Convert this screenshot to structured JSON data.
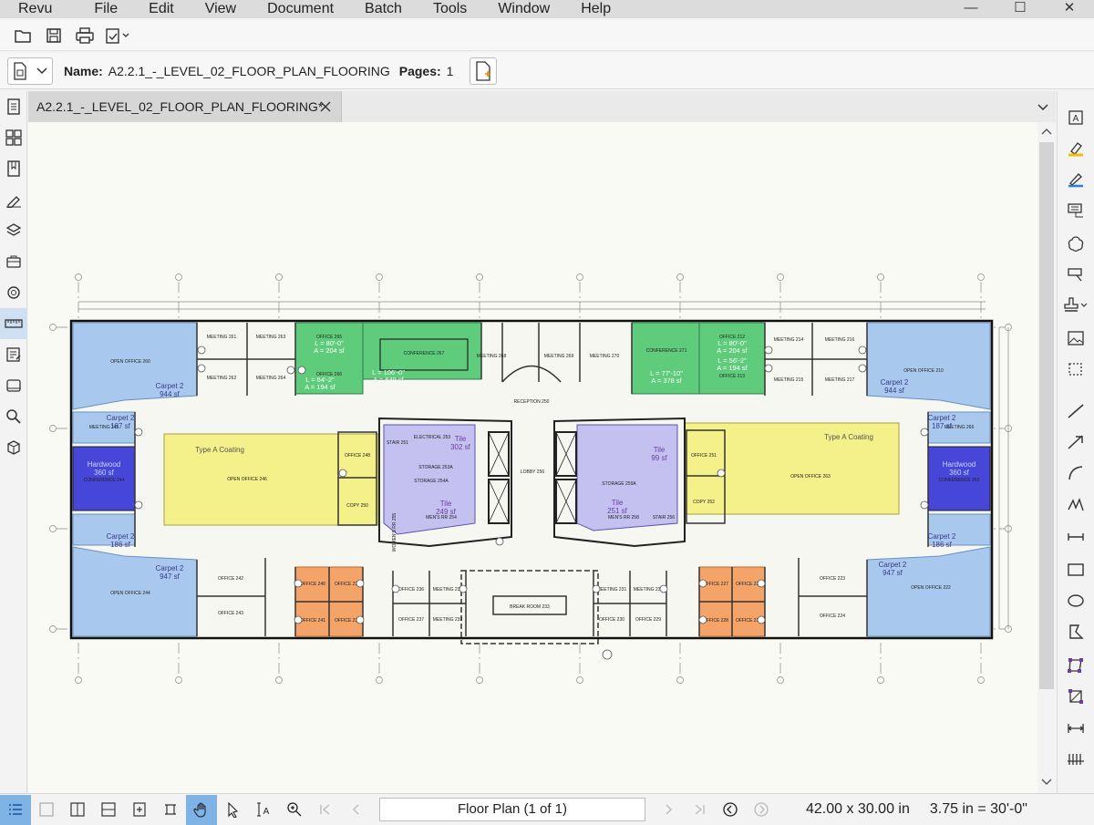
{
  "menu": [
    "Revu",
    "File",
    "Edit",
    "View",
    "Document",
    "Batch",
    "Tools",
    "Window",
    "Help"
  ],
  "window_controls": [
    "—",
    "☐",
    "✕"
  ],
  "document": {
    "name_label": "Name:",
    "name_value": "A2.2.1_-_LEVEL_02_FLOOR_PLAN_FLOORING",
    "pages_label": "Pages:",
    "pages_value": "1"
  },
  "tab": {
    "title": "A2.2.1_-_LEVEL_02_FLOOR_PLAN_FLOORING*"
  },
  "plan": {
    "top_rooms_left": [
      "OPEN OFFICE 260",
      "MEETING 261",
      "MEETING 263",
      "MEETING 262",
      "MEETING 264",
      "OFFICE 265",
      "OFFICE 266",
      "CONFERENCE 267"
    ],
    "top_rooms_center": [
      "MEETING 268",
      "MEETING 269",
      "MEETING 270"
    ],
    "top_rooms_right": [
      "CONFERENCE 271",
      "OFFICE 212",
      "OFFICE 213",
      "MEETING 214",
      "MEETING 216",
      "MEETING 215",
      "MEETING 217",
      "OPEN OFFICE 210"
    ],
    "reception": "RECEPTION 250",
    "lobby": "LOBBY 256",
    "core_left": [
      "STAIR 251",
      "ELECTRICAL 253",
      "STORAGE 253A",
      "STORAGE 254A",
      "MEN'S RR 254",
      "WOMEN'S RR 255"
    ],
    "core_right": [
      "STORAGE 259A",
      "MEN'S RR 258",
      "STAIR 256"
    ],
    "open_office_left": "OPEN OFFICE 246",
    "open_office_right": "OPEN OFFICE 263",
    "office_248": "OFFICE 248",
    "copy_250": "COPY 250",
    "office_251": "OFFICE 251",
    "copy_252": "COPY 252",
    "conference_left": "CONFERENCE 244",
    "conference_right": "CONFERENCE 265",
    "meeting_left": "MEETING 245",
    "meeting_right": "MEETING 266",
    "bottom_rooms": [
      "OPEN OFFICE 244",
      "OFFICE 242",
      "OFFICE 243",
      "OFFICE 240",
      "OFFICE 239",
      "OFFICE 241",
      "OFFICE 238",
      "OFFICE 236",
      "OFFICE 237",
      "MEETING 234",
      "MEETING 233",
      "BREAK ROOM 233",
      "MEETING 231",
      "OFFICE 230",
      "MEETING 232",
      "OFFICE 229",
      "OFFICE 227",
      "OFFICE 225",
      "OFFICE 228",
      "OFFICE 226",
      "OFFICE 223",
      "OFFICE 224",
      "OPEN OFFICE 222"
    ],
    "markups": {
      "carpet_tl": [
        "Carpet 2",
        "944 sf"
      ],
      "carpet_tr": [
        "Carpet 2",
        "944 sf"
      ],
      "carpet_ml": [
        "Carpet 2",
        "187 sf"
      ],
      "carpet_mr": [
        "Carpet 2",
        "187 sf"
      ],
      "carpet_ml2": [
        "Carpet 2",
        "186 sf"
      ],
      "carpet_mr2": [
        "Carpet 2",
        "186 sf"
      ],
      "carpet_bl": [
        "Carpet 2",
        "947 sf"
      ],
      "carpet_br": [
        "Carpet 2",
        "947 sf"
      ],
      "hardwood_l": [
        "Hardwood",
        "360 sf"
      ],
      "hardwood_r": [
        "Hardwood",
        "360 sf"
      ],
      "coating_l": "Type A Coating",
      "coating_r": "Type A Coating",
      "tile_l": [
        "Tile",
        "302 sf"
      ],
      "tile_l2": [
        "Tile",
        "249 sf"
      ],
      "tile_r": [
        "Tile",
        "251 sf"
      ],
      "tile_r2": [
        "Tile",
        "99 sf"
      ],
      "green_1": [
        "L = 80'-0\"",
        "A = 204 sf"
      ],
      "green_2": [
        "L = 106'-0\"",
        "A = 649 sf"
      ],
      "green_3": [
        "L = 64'-2\"",
        "A = 194 sf"
      ],
      "green_4": [
        "L = 80'-0\"",
        "A = 204 sf"
      ],
      "green_5": [
        "L = 77'-10\"",
        "A = 378 sf"
      ],
      "green_6": [
        "L = 56'-2\"",
        "A = 194 sf"
      ]
    }
  },
  "status": {
    "page_indicator": "Floor Plan (1 of 1)",
    "page_size": "42.00 x 30.00 in",
    "scale": "3.75 in = 30'-0\""
  },
  "colors": {
    "carpet_blue": "#a9c8ee",
    "hardwood": "#4646d8",
    "coating_yellow": "#f4f08a",
    "tile_purple": "#c4c0ef",
    "green_area": "#5fcc7c",
    "orange_area": "#f4a468",
    "active_tool": "#7fb3e6"
  },
  "icons": {
    "left_panel": [
      "file-access-icon",
      "thumbnails-icon",
      "bookmarks-icon",
      "signatures-icon",
      "layers-icon",
      "toolchest-icon",
      "properties-icon",
      "measurements-icon",
      "markups-list-icon",
      "studio-icon",
      "search-icon",
      "3d-icon"
    ],
    "right_tools": [
      "text-box-icon",
      "highlighter-icon",
      "pen-icon",
      "callout-icon",
      "cloud-icon",
      "flag-icon",
      "stamp-icon",
      "image-icon",
      "crop-icon",
      "line-icon",
      "arrow-icon",
      "arc-icon",
      "polyline-icon",
      "dimension-icon",
      "rectangle-icon",
      "ellipse-icon",
      "polygon-icon",
      "perimeter-icon",
      "area-icon",
      "length-icon",
      "count-icon"
    ]
  }
}
